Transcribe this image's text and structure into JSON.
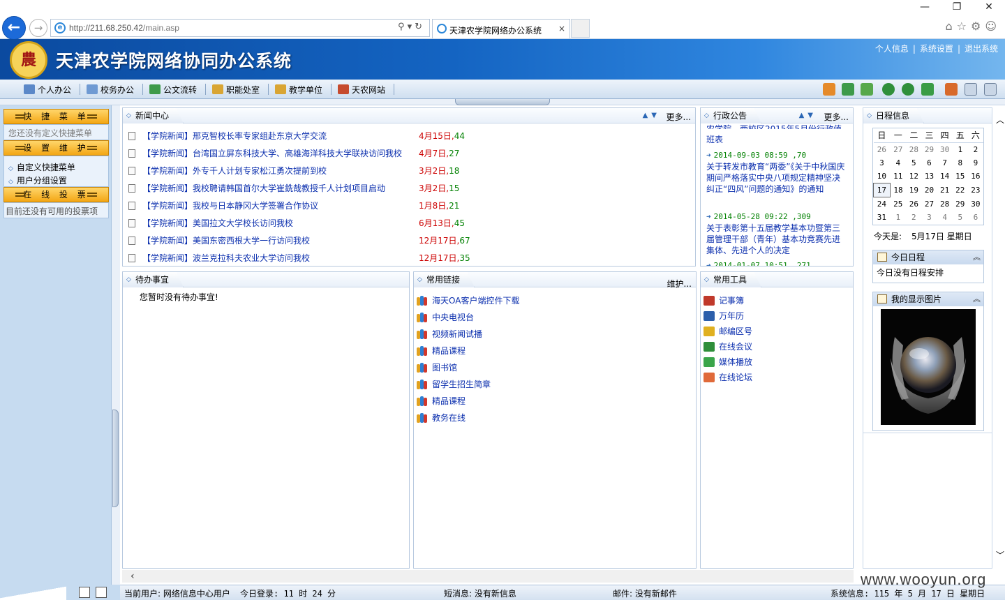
{
  "browser": {
    "url_host": "http://211.68.250.42",
    "url_path": "/main.asp",
    "tab_title": "天津农学院网络办公系统",
    "tab_close": "×",
    "window_minimize": "—",
    "window_restore": "❐",
    "window_close": "✕"
  },
  "header": {
    "title": "天津农学院网络协同办公系统",
    "links": [
      "个人信息",
      "系统设置",
      "退出系统"
    ]
  },
  "toolbar": {
    "items": [
      "个人办公",
      "校务办公",
      "公文流转",
      "职能处室",
      "教学单位",
      "天农网站"
    ]
  },
  "sidebar": {
    "shortcut_title": "快 捷 菜 单",
    "shortcut_empty": "您还没有定义快捷菜单",
    "settings_title": "设 置 维 护",
    "settings_items": [
      "自定义快捷菜单",
      "用户分组设置"
    ],
    "vote_title": "在 线 投 票",
    "vote_empty": "目前还没有可用的投票项"
  },
  "news": {
    "title": "新闻中心",
    "more": "更多...",
    "items": [
      {
        "title": "【学院新闻】邢克智校长率专家组赴东京大学交流",
        "date": "4月15日",
        "count": "44"
      },
      {
        "title": "【学院新闻】台湾国立屏东科技大学、高雄海洋科技大学联袂访问我校",
        "date": "4月7日",
        "count": "27"
      },
      {
        "title": "【学院新闻】外专千人计划专家松江勇次提前到校",
        "date": "3月2日",
        "count": "18"
      },
      {
        "title": "【学院新闻】我校聘请韩国首尔大学崔銑哉教授千人计划项目启动",
        "date": "3月2日",
        "count": "15"
      },
      {
        "title": "【学院新闻】我校与日本静冈大学签署合作协议",
        "date": "1月8日",
        "count": "21"
      },
      {
        "title": "【学院新闻】美国拉文大学校长访问我校",
        "date": "6月13日",
        "count": "45"
      },
      {
        "title": "【学院新闻】美国东密西根大学一行访问我校",
        "date": "12月17日",
        "count": "67"
      },
      {
        "title": "【学院新闻】波兰克拉科夫农业大学访问我校",
        "date": "12月17日",
        "count": "35"
      }
    ]
  },
  "notices": {
    "title": "行政公告",
    "more": "更多...",
    "top_partial_1": "农学院、西校区2015年5月份行政值",
    "top_partial_2": "班表",
    "items": [
      {
        "meta": "2014-09-03 08:59 ,70",
        "text": "关于转发市教育“两委”《关于中秋国庆期间严格落实中央八项规定精神坚决纠正“四风”问题的通知》的通知"
      },
      {
        "meta": "2014-05-28 09:22 ,309",
        "text": "关于表彰第十五届教学基本功暨第三届管理干部（青年）基本功竞赛先进集体、先进个人的决定"
      },
      {
        "meta": "2014-01-07 10:51 ,271",
        "text": ""
      }
    ]
  },
  "todo": {
    "title": "待办事宜",
    "empty": "您暂时没有待办事宜!"
  },
  "links": {
    "title": "常用链接",
    "maintain": "维护...",
    "items": [
      "海天OA客户端控件下载",
      "中央电视台",
      "视频新闻试播",
      "精品课程",
      "图书馆",
      "留学生招生简章",
      "精品课程",
      "教务在线"
    ]
  },
  "tools": {
    "title": "常用工具",
    "items": [
      "记事簿",
      "万年历",
      "邮编区号",
      "在线会议",
      "媒体播放",
      "在线论坛"
    ],
    "colors": [
      "#c0392b",
      "#2c5fab",
      "#e0b020",
      "#2f8f3a",
      "#3aa54a",
      "#e06a3a"
    ]
  },
  "schedule": {
    "title": "日程信息",
    "weekdays": [
      "日",
      "一",
      "二",
      "三",
      "四",
      "五",
      "六"
    ],
    "today_label": "今天是:",
    "today_value": "5月17日 星期日",
    "today_box_title": "今日日程",
    "today_box_text": "今日没有日程安排",
    "photo_box_title": "我的显示图片",
    "weeks": [
      [
        "26",
        "27",
        "28",
        "29",
        "30",
        "1",
        "2"
      ],
      [
        "3",
        "4",
        "5",
        "6",
        "7",
        "8",
        "9"
      ],
      [
        "10",
        "11",
        "12",
        "13",
        "14",
        "15",
        "16"
      ],
      [
        "17",
        "18",
        "19",
        "20",
        "21",
        "22",
        "23"
      ],
      [
        "24",
        "25",
        "26",
        "27",
        "28",
        "29",
        "30"
      ],
      [
        "31",
        "1",
        "2",
        "3",
        "4",
        "5",
        "6"
      ]
    ]
  },
  "status": {
    "user": "当前用户: 网络信息中心用户",
    "login": "今日登录: 11 时 24 分",
    "sms": "短消息: 没有新信息",
    "mail": "邮件: 没有新邮件",
    "sys": "系统信息: 115 年 5 月 17 日 星期日"
  },
  "watermark": "www.wooyun.org"
}
